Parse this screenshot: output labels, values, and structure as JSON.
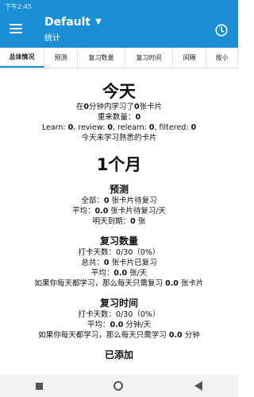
{
  "status_bar": {
    "time": "下午2:45"
  },
  "app_bar": {
    "title": "Default",
    "subtitle": "统计"
  },
  "tabs": [
    {
      "label": "总体情况"
    },
    {
      "label": "预测"
    },
    {
      "label": "复习数量"
    },
    {
      "label": "复习时间"
    },
    {
      "label": "间隔"
    },
    {
      "label": "按小"
    }
  ],
  "today": {
    "heading": "今天",
    "studied": {
      "pre": "在",
      "minutes": "0",
      "mid": "分钟内学习了",
      "cards": "0",
      "post": "张卡片"
    },
    "relearn": {
      "pre": "重来数量：",
      "value": "0"
    },
    "breakdown": {
      "learn_label": "Learn: ",
      "learn": "0",
      "review_label": ", review: ",
      "review": "0",
      "relearn_label": ", relearn: ",
      "relearn": "0",
      "filtered_label": ", filtered: ",
      "filtered": "0"
    },
    "mature": "今天未学习熟悉的卡片"
  },
  "month": {
    "heading": "1个月",
    "forecast": {
      "heading": "预测",
      "total": {
        "pre": "全部：",
        "value": "0",
        "post": " 张卡片待复习"
      },
      "average": {
        "pre": "平均：",
        "value": "0.0",
        "post": " 张卡片待复习/天"
      },
      "tomorrow": {
        "pre": "明天到期：",
        "value": "0",
        "post": " 张"
      }
    },
    "review_count": {
      "heading": "复习数量",
      "days": {
        "pre": "打卡天数：",
        "value": "0/30（0%）"
      },
      "total": {
        "pre": "总共：",
        "value": "0",
        "post": " 张卡片已复习"
      },
      "average": {
        "pre": "平均：",
        "value": "0.0",
        "post": " 张/天"
      },
      "if_daily": {
        "pre": "如果你每天都学习，那么每天只需复习 ",
        "value": "0.0",
        "post": " 张卡片"
      }
    },
    "review_time": {
      "heading": "复习时间",
      "days": {
        "pre": "打卡天数：",
        "value": "0/30（0%）"
      },
      "average": {
        "pre": "平均：",
        "value": "0.0",
        "post": " 分钟/天"
      },
      "if_daily": {
        "pre": "如果你每天都学习，那么每天只需学习 ",
        "value": "0.0",
        "post": " 分钟"
      }
    },
    "added": {
      "heading": "已添加"
    }
  },
  "colors": {
    "primary": "#1a8fd6"
  },
  "icons": {
    "menu": "hamburger-icon",
    "deck_dropdown": "caret-down-icon",
    "time_range": "clock-icon"
  }
}
